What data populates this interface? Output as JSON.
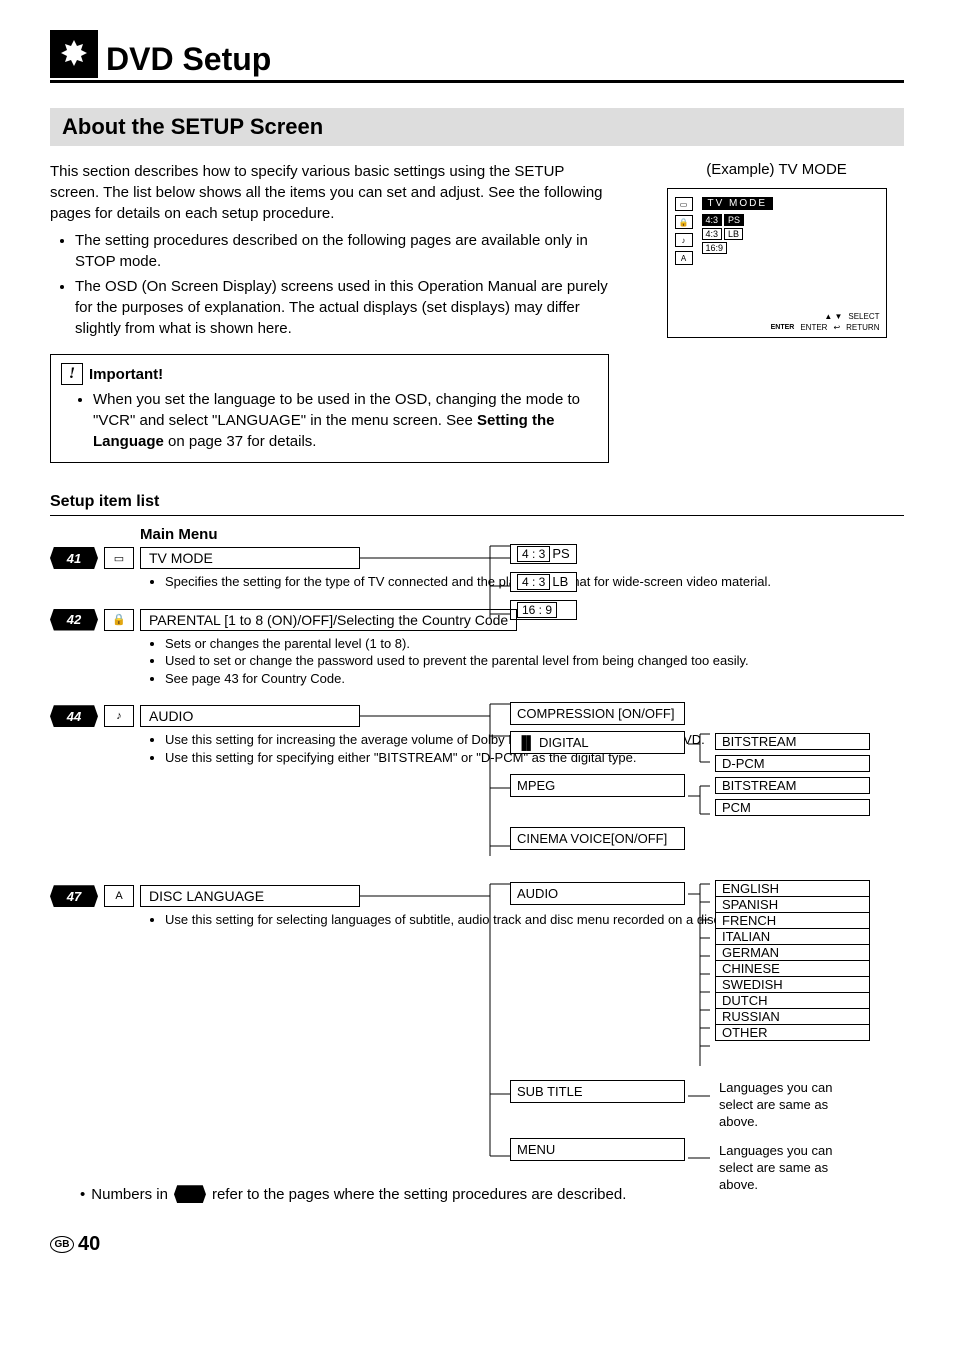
{
  "header": {
    "title": "DVD Setup"
  },
  "section": {
    "title": "About the SETUP Screen"
  },
  "intro": {
    "text": "This section describes how to specify various basic settings using the SETUP screen. The list below shows all the items you can set and adjust. See the following pages for details on each setup procedure.",
    "bullets": [
      "The setting procedures described on the following pages are available only in STOP mode.",
      "The OSD (On Screen Display) screens used in this Operation Manual are purely for the purposes of explanation. The actual displays (set displays) may differ slightly from what is shown here."
    ]
  },
  "important": {
    "label": "Important!",
    "text_prefix": "When you set the language to be used in the OSD, changing the mode to \"VCR\" and select \"LANGUAGE\" in the menu screen. See ",
    "bold": "Setting the Language",
    "text_suffix": " on page 37 for details."
  },
  "example": {
    "label": "(Example) TV MODE",
    "menu_title": "TV MODE",
    "opts": [
      "4:3 PS",
      "4:3 LB",
      "16:9"
    ],
    "foot_select": "SELECT",
    "foot_enter": "ENTER",
    "foot_enter_key": "ENTER",
    "foot_return": "RETURN"
  },
  "setup_header": "Setup item list",
  "mainmenu_label": "Main Menu",
  "items": {
    "tv": {
      "page": "41",
      "title": "TV MODE",
      "desc": "Specifies the setting for the type of TV connected and the playback format for wide-screen video material.",
      "opts": [
        "4 : 3 PS",
        "4 : 3 LB",
        "16 : 9"
      ]
    },
    "parental": {
      "page": "42",
      "title": "PARENTAL [1 to 8 (ON)/OFF]/Selecting the Country Code",
      "desc": [
        "Sets or changes the parental level (1 to 8).",
        "Used to set or change the password used to prevent the parental level from being changed too easily.",
        "See page 43 for Country Code."
      ]
    },
    "audio": {
      "page": "44",
      "title": "AUDIO",
      "desc": [
        "Use this setting for increasing the average volume of Dolby Digital audio when playing a DVD.",
        "Use this setting for specifying either \"BITSTREAM\" or \"D-PCM\" as the digital type."
      ],
      "subs": {
        "compression": "COMPRESSION [ON/OFF]",
        "digital": "DIGITAL",
        "digital_opts": [
          "BITSTREAM",
          "D-PCM"
        ],
        "mpeg": "MPEG",
        "mpeg_opts": [
          "BITSTREAM",
          "PCM"
        ],
        "cinema": "CINEMA VOICE[ON/OFF]"
      }
    },
    "disc": {
      "page": "47",
      "title": "DISC LANGUAGE",
      "desc": "Use this setting for selecting languages of subtitle, audio track and disc menu recorded on a disc.",
      "subs": {
        "audio": "AUDIO",
        "langs": [
          "ENGLISH",
          "SPANISH",
          "FRENCH",
          "ITALIAN",
          "GERMAN",
          "CHINESE",
          "SWEDISH",
          "DUTCH",
          "RUSSIAN",
          "OTHER"
        ],
        "subtitle": "SUB TITLE",
        "subtitle_note": "Languages you can select are same as above.",
        "menu": "MENU",
        "menu_note": "Languages you can select are same as above."
      }
    }
  },
  "note": {
    "prefix": "Numbers in ",
    "suffix": " refer to the pages where the setting procedures are described."
  },
  "footer": {
    "gb": "GB",
    "page": "40"
  }
}
